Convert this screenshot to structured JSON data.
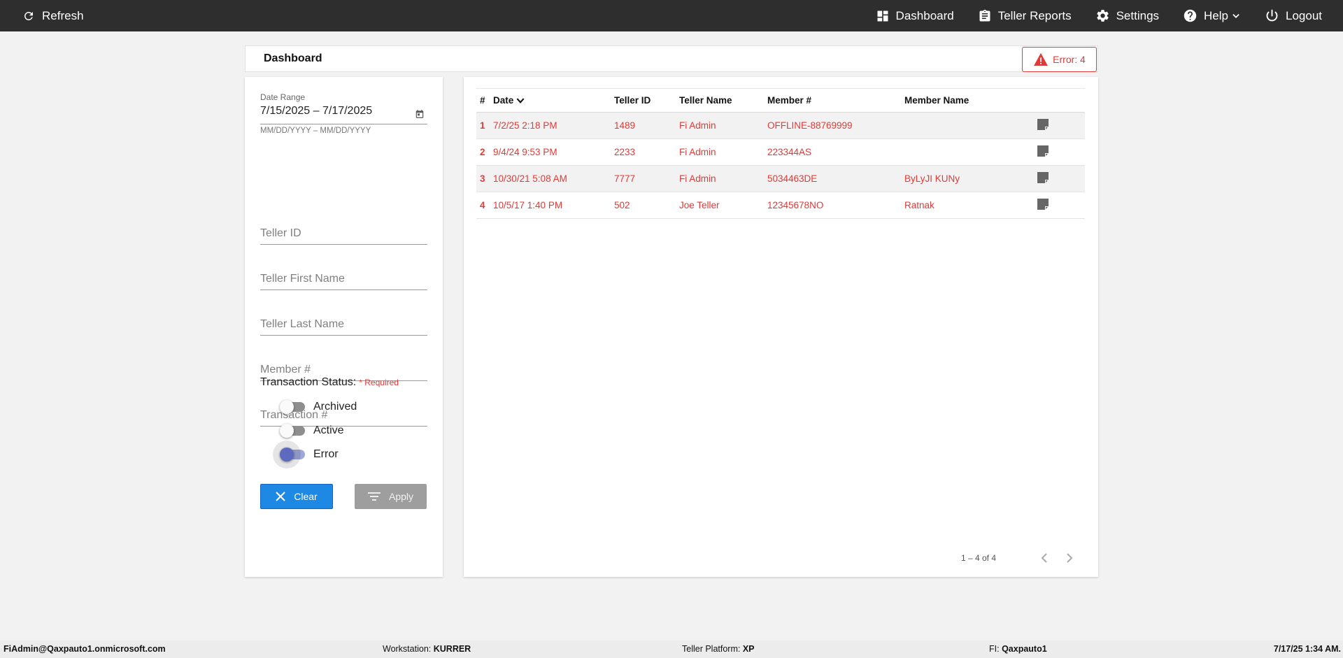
{
  "topbar": {
    "refresh_label": "Refresh",
    "nav": [
      {
        "label": "Dashboard",
        "icon": "dashboard-icon"
      },
      {
        "label": "Teller Reports",
        "icon": "clipboard-icon"
      },
      {
        "label": "Settings",
        "icon": "gear-icon"
      },
      {
        "label": "Help",
        "icon": "help-icon"
      },
      {
        "label": "Logout",
        "icon": "power-icon"
      }
    ]
  },
  "header": {
    "title": "Dashboard",
    "error_badge": "Error: 4"
  },
  "filters": {
    "date_range_label": "Date Range",
    "date_range_value": "7/15/2025 – 7/17/2025",
    "date_range_hint": "MM/DD/YYYY – MM/DD/YYYY",
    "teller_id_placeholder": "Teller ID",
    "teller_first_name_placeholder": "Teller First Name",
    "teller_last_name_placeholder": "Teller Last Name",
    "member_placeholder": "Member #",
    "transaction_placeholder": "Transaction #",
    "status_label": "Transaction Status:",
    "required_label": "* Required",
    "statuses": [
      {
        "label": "Archived",
        "on": false
      },
      {
        "label": "Active",
        "on": false
      },
      {
        "label": "Error",
        "on": true
      }
    ],
    "clear_label": "Clear",
    "apply_label": "Apply"
  },
  "table": {
    "columns": [
      "#",
      "Date",
      "Teller ID",
      "Teller Name",
      "Member #",
      "Member Name"
    ],
    "rows": [
      {
        "num": "1",
        "date": "7/2/25 2:18 PM",
        "teller_id": "1489",
        "teller_name": "Fi Admin",
        "member": "OFFLINE-88769999",
        "member_name": ""
      },
      {
        "num": "2",
        "date": "9/4/24 9:53 PM",
        "teller_id": "2233",
        "teller_name": "Fi Admin",
        "member": "223344AS",
        "member_name": ""
      },
      {
        "num": "3",
        "date": "10/30/21 5:08 AM",
        "teller_id": "7777",
        "teller_name": "Fi Admin",
        "member": "5034463DE",
        "member_name": "ByLyJI KUNy"
      },
      {
        "num": "4",
        "date": "10/5/17 1:40 PM",
        "teller_id": "502",
        "teller_name": "Joe Teller",
        "member": "12345678NO",
        "member_name": "Ratnak"
      }
    ],
    "pager_range": "1 – 4 of 4"
  },
  "footer": {
    "user": "FiAdmin@Qaxpauto1.onmicrosoft.com",
    "workstation_label": "Workstation:",
    "workstation_value": "KURRER",
    "platform_label": "Teller Platform:",
    "platform_value": "XP",
    "fi_label": "FI:",
    "fi_value": "Qaxpauto1",
    "datetime": "7/17/25 1:34 AM."
  },
  "colors": {
    "topbar": "#2e2e2e",
    "error_red": "#e53935",
    "clear_blue": "#1e88e5",
    "apply_gray": "#9e9e9e",
    "toggle_on": "#5c6bc0"
  }
}
